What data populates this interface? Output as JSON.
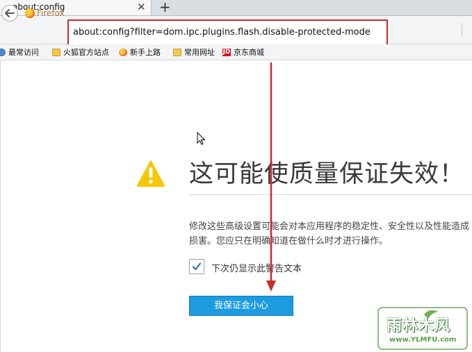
{
  "tab": {
    "title": "about:config",
    "close_glyph": "✕",
    "new_tab_glyph": "+"
  },
  "nav": {
    "identity_label": "Firefox",
    "url": "about:config?filter=dom.ipc.plugins.flash.disable-protected-mode"
  },
  "bookmarks": [
    {
      "label": "最常访问",
      "icon": "globe-icon"
    },
    {
      "label": "火狐官方站点",
      "icon": "folder-icon"
    },
    {
      "label": "新手上路",
      "icon": "firefox-icon"
    },
    {
      "label": "常用网址",
      "icon": "folder-icon"
    },
    {
      "label": "京东商城",
      "icon": "jd-icon",
      "icon_text": "JD"
    }
  ],
  "warning": {
    "title": "这可能使质量保证失效！",
    "description": "修改这些高级设置可能会对本应用程序的稳定性、安全性以及性能造成损害。您应只在明确知道在做什么时才进行操作。",
    "checkbox_label": "下次仍显示此警告文本",
    "checkbox_checked": true,
    "accept_button": "我保证会小心"
  },
  "watermark": {
    "text": "雨林木风",
    "url": "www.YLMFU.com"
  },
  "colors": {
    "annotation_red": "#cc2a2a",
    "button_blue": "#1e9be0",
    "warning_yellow": "#f7c600"
  }
}
